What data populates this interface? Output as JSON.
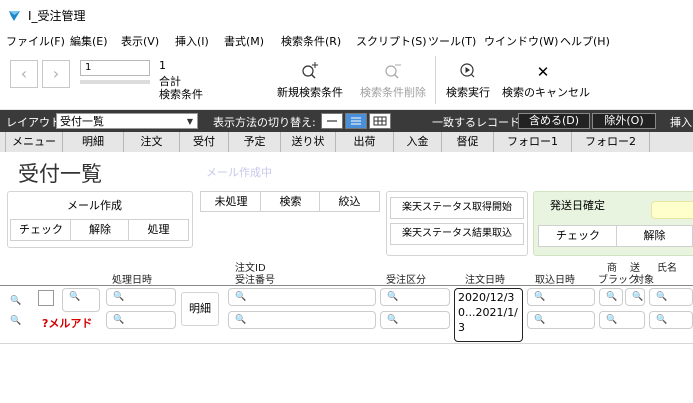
{
  "window": {
    "title": "I_受注管理"
  },
  "menu": [
    "ファイル(F)",
    "編集(E)",
    "表示(V)",
    "挿入(I)",
    "書式(M)",
    "検索条件(R)",
    "スクリプト(S)",
    "ツール(T)",
    "ウインドウ(W)",
    "ヘルプ(H)"
  ],
  "toolbar": {
    "record_value": "1",
    "record_count": "1",
    "total_label": "合計",
    "find_criteria_label": "検索条件",
    "new_find_label": "新規検索条件",
    "delete_find_label": "検索条件削除",
    "perform_find_label": "検索実行",
    "cancel_find_label": "検索のキャンセル"
  },
  "layoutbar": {
    "layout_label": "レイアウト:",
    "layout_value": "受付一覧",
    "view_as_label": "表示方法の切り替え:",
    "matching_label": "一致するレコード:",
    "include_label": "含める(D)",
    "omit_label": "除外(O)",
    "insert_label": "挿入"
  },
  "tabs": [
    "メニュー",
    "明細",
    "注文",
    "受付",
    "予定",
    "送り状",
    "出荷",
    "入金",
    "督促",
    "フォロー1",
    "フォロー2"
  ],
  "page": {
    "title": "受付一覧",
    "email_note": "メール作成中"
  },
  "mail_panel": {
    "title": "メール作成",
    "check": "チェック",
    "cancel": "解除",
    "process": "処理"
  },
  "filter_buttons": [
    "未処理",
    "検索",
    "絞込"
  ],
  "rakuten_panel": {
    "start_label": "楽天ステータス取得開始",
    "result_label": "楽天ステータス結果取込"
  },
  "shipping_panel": {
    "title": "発送日確定",
    "check": "チェック",
    "cancel": "解除"
  },
  "columns": {
    "processed_at": "処理日時",
    "order_id": "注文ID",
    "receipt_no": "受注番号",
    "order_type": "受注区分",
    "order_datetime": "注文日時",
    "trade_datetime": "取込日時",
    "blacklist_top": "商",
    "blacklist": "ブラック",
    "ship_top": "送",
    "ship_target": "対象",
    "name": "氏名"
  },
  "row": {
    "meisai": "明細",
    "mail_alert": "?メルアド",
    "order_date_value": "2020/12/3\n0...2021/1/\n3"
  },
  "icons": {
    "search": "search-icon",
    "magnifier_char": "🔍"
  }
}
